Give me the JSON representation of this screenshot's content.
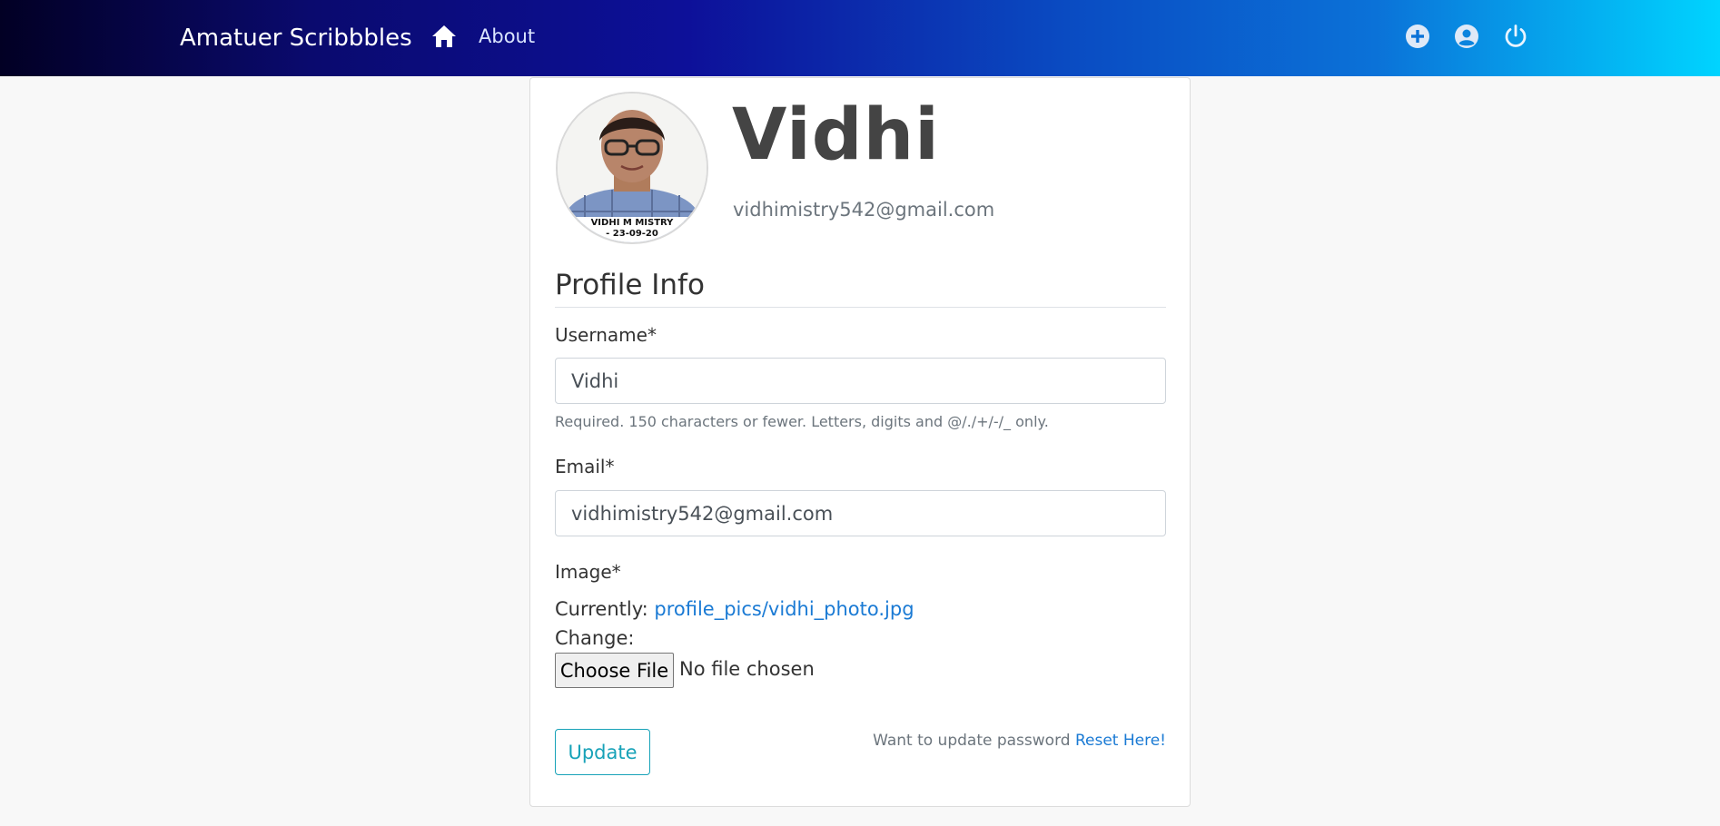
{
  "navbar": {
    "brand": "Amatuer Scribbbles",
    "about_label": "About",
    "icons": [
      "home-icon",
      "add-circle-icon",
      "account-circle-icon",
      "power-icon"
    ],
    "gradient_colors": [
      "#020024",
      "#0d1099",
      "#0a4bc2",
      "#00d4ff"
    ]
  },
  "profile": {
    "name": "Vidhi",
    "email": "vidhimistry542@gmail.com",
    "photo_caption_line1": "VIDHI M MISTRY",
    "photo_caption_line2": "- 23-09-20"
  },
  "form": {
    "legend": "Profile Info",
    "username_label": "Username*",
    "username_value": "Vidhi",
    "username_help": "Required. 150 characters or fewer. Letters, digits and @/./+/-/_ only.",
    "email_label": "Email*",
    "email_value": "vidhimistry542@gmail.com",
    "image_label": "Image*",
    "currently_label": "Currently:",
    "current_image_link": "profile_pics/vidhi_photo.jpg",
    "change_label": "Change:",
    "choose_file_label": "Choose File",
    "file_status": "No file chosen",
    "update_label": "Update",
    "password_prompt": "Want to update password",
    "reset_link": "Reset Here!"
  },
  "colors": {
    "accent": "#17a2b8",
    "link": "#1a7ad4",
    "muted": "#6c757d"
  }
}
